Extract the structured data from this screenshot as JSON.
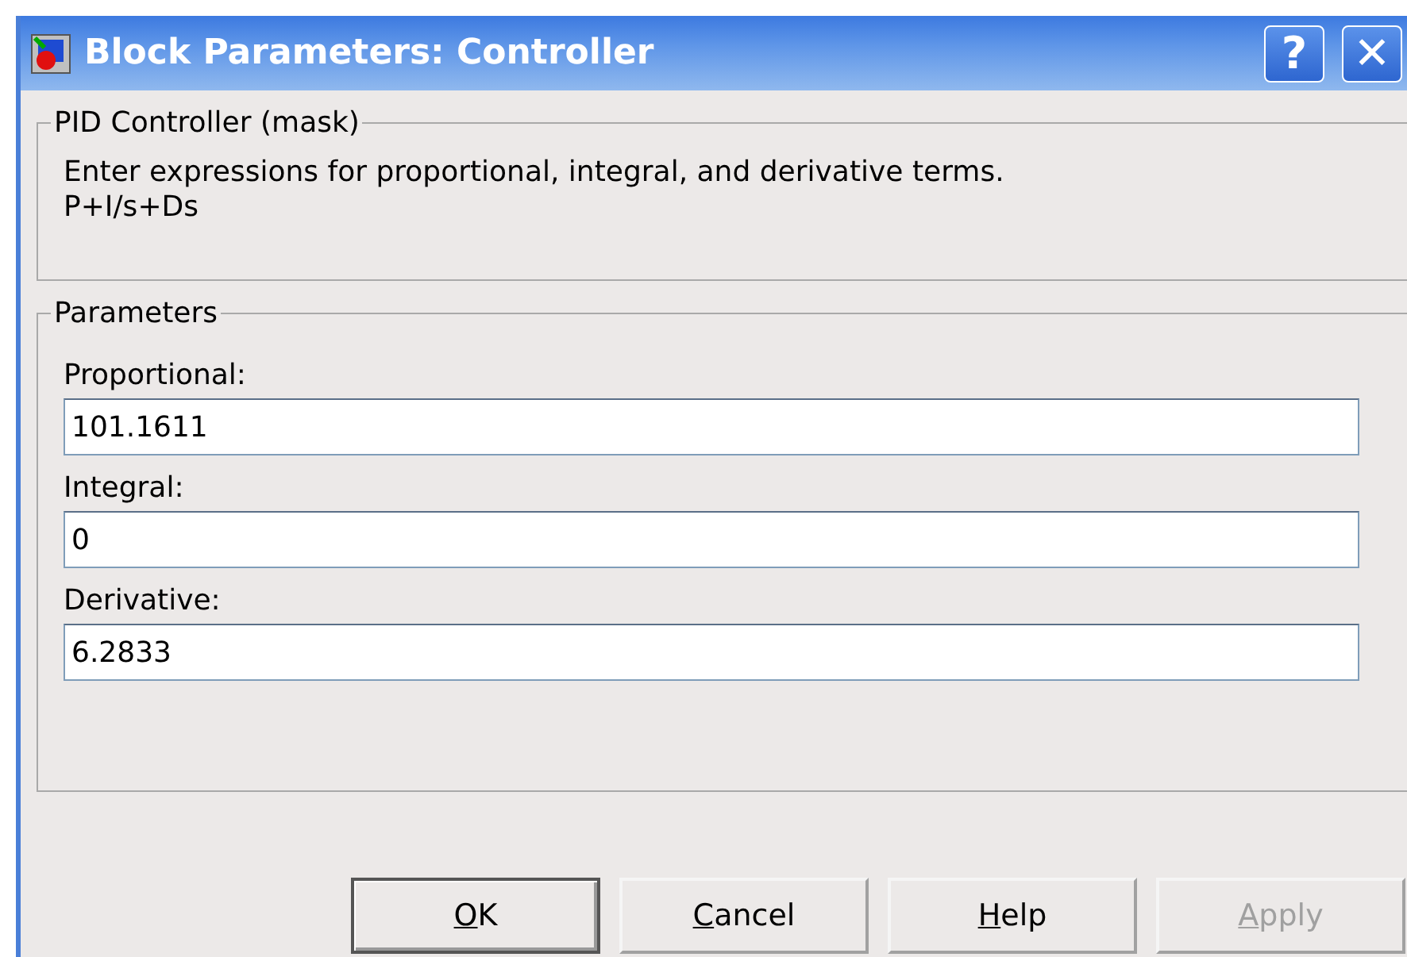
{
  "window": {
    "title": "Block Parameters: Controller",
    "title_buttons": [
      "?",
      "✕"
    ]
  },
  "mask_group": {
    "title": "PID Controller (mask)",
    "lines": [
      "Enter expressions for proportional, integral, and derivative terms.",
      "P+I/s+Ds"
    ]
  },
  "parameters_group": {
    "title": "Parameters",
    "fields": [
      {
        "label": "Proportional:",
        "value": "101.1611"
      },
      {
        "label": "Integral:",
        "value": "0"
      },
      {
        "label": "Derivative:",
        "value": "6.2833"
      }
    ]
  },
  "buttons": [
    {
      "label": "OK",
      "default": true,
      "disabled": false
    },
    {
      "label": "Cancel",
      "default": false,
      "disabled": false
    },
    {
      "label": "Help",
      "default": false,
      "disabled": false
    },
    {
      "label": "Apply",
      "default": false,
      "disabled": true
    }
  ]
}
